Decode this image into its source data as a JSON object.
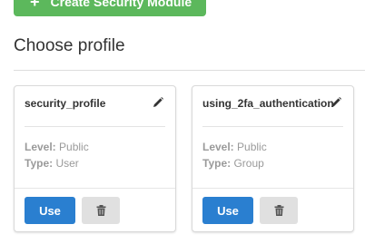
{
  "toolbar": {
    "create_label": "Create Security Module",
    "create_icon": "plus-icon"
  },
  "section": {
    "title": "Choose profile"
  },
  "profiles": [
    {
      "name": "security_profile",
      "level_label": "Level:",
      "level_value": "Public",
      "type_label": "Type:",
      "type_value": "User",
      "use_label": "Use",
      "edit_icon": "pencil-icon",
      "delete_icon": "trash-icon"
    },
    {
      "name": "using_2fa_authentication",
      "level_label": "Level:",
      "level_value": "Public",
      "type_label": "Type:",
      "type_value": "Group",
      "use_label": "Use",
      "edit_icon": "pencil-icon",
      "delete_icon": "trash-icon"
    }
  ],
  "colors": {
    "primary": "#2a7fd0",
    "success": "#5cb85c",
    "muted": "#9a9a9a"
  }
}
